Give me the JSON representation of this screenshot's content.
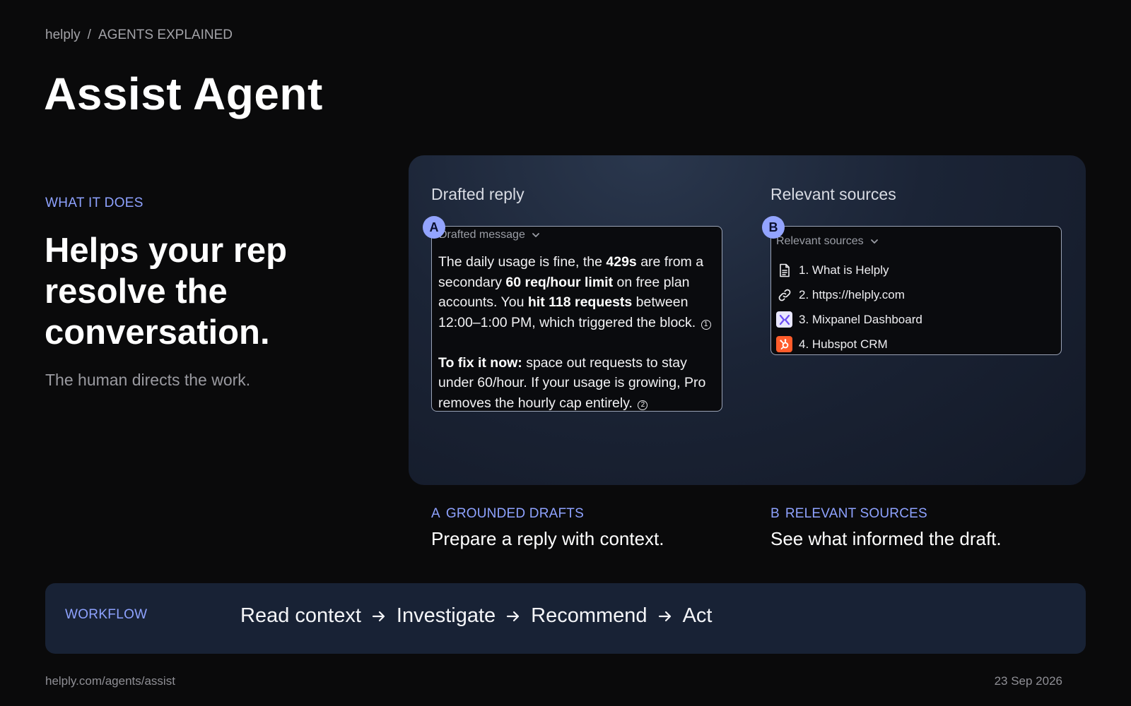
{
  "breadcrumb": {
    "brand": "helply",
    "separator": "/",
    "section": "AGENTS EXPLAINED"
  },
  "page_title": "Assist Agent",
  "intro": {
    "label": "WHAT IT DOES",
    "headline": "Helps your rep resolve the conversation.",
    "subline": "The human directs the work."
  },
  "panel": {
    "draft": {
      "heading": "Drafted reply",
      "badge": "A",
      "dropdown_label": "Drafted message",
      "paragraph1": [
        {
          "text": "The daily usage is fine, the ",
          "bold": false
        },
        {
          "text": "429s",
          "bold": true
        },
        {
          "text": " are from a secondary ",
          "bold": false
        },
        {
          "text": "60 req/hour limit",
          "bold": true
        },
        {
          "text": " on free plan accounts. You ",
          "bold": false
        },
        {
          "text": "hit 118 requests",
          "bold": true
        },
        {
          "text": " between 12:00–1:00 PM, which triggered the block. ",
          "bold": false
        }
      ],
      "citation1": "1",
      "paragraph2": [
        {
          "text": "To fix it now:",
          "bold": true
        },
        {
          "text": " space out requests to stay under 60/hour. If your usage is growing, Pro removes the hourly cap entirely. ",
          "bold": false
        }
      ],
      "citation2": "2"
    },
    "sources": {
      "heading": "Relevant sources",
      "badge": "B",
      "dropdown_label": "Relevant sources",
      "items": [
        {
          "label": "1. What is Helply",
          "icon": "document-icon"
        },
        {
          "label": "2. https://helply.com",
          "icon": "link-icon"
        },
        {
          "label": "3. Mixpanel Dashboard",
          "icon": "mixpanel-icon"
        },
        {
          "label": "4. Hubspot CRM",
          "icon": "hubspot-icon"
        }
      ]
    }
  },
  "captions": [
    {
      "letter": "A",
      "label": "GROUNDED DRAFTS",
      "text": "Prepare a reply with context."
    },
    {
      "letter": "B",
      "label": "RELEVANT SOURCES",
      "text": "See what informed the draft."
    }
  ],
  "workflow": {
    "label": "WORKFLOW",
    "steps": [
      "Read context",
      "Investigate",
      "Recommend",
      "Act"
    ]
  },
  "footer": {
    "url": "helply.com/agents/assist",
    "date": "23 Sep 2026"
  },
  "colors": {
    "accent": "#8ea2ff",
    "badge": "#93a4ff",
    "background": "#0a0a0b",
    "workflow_bg": "#182235",
    "hubspot": "#ff5c2b"
  }
}
